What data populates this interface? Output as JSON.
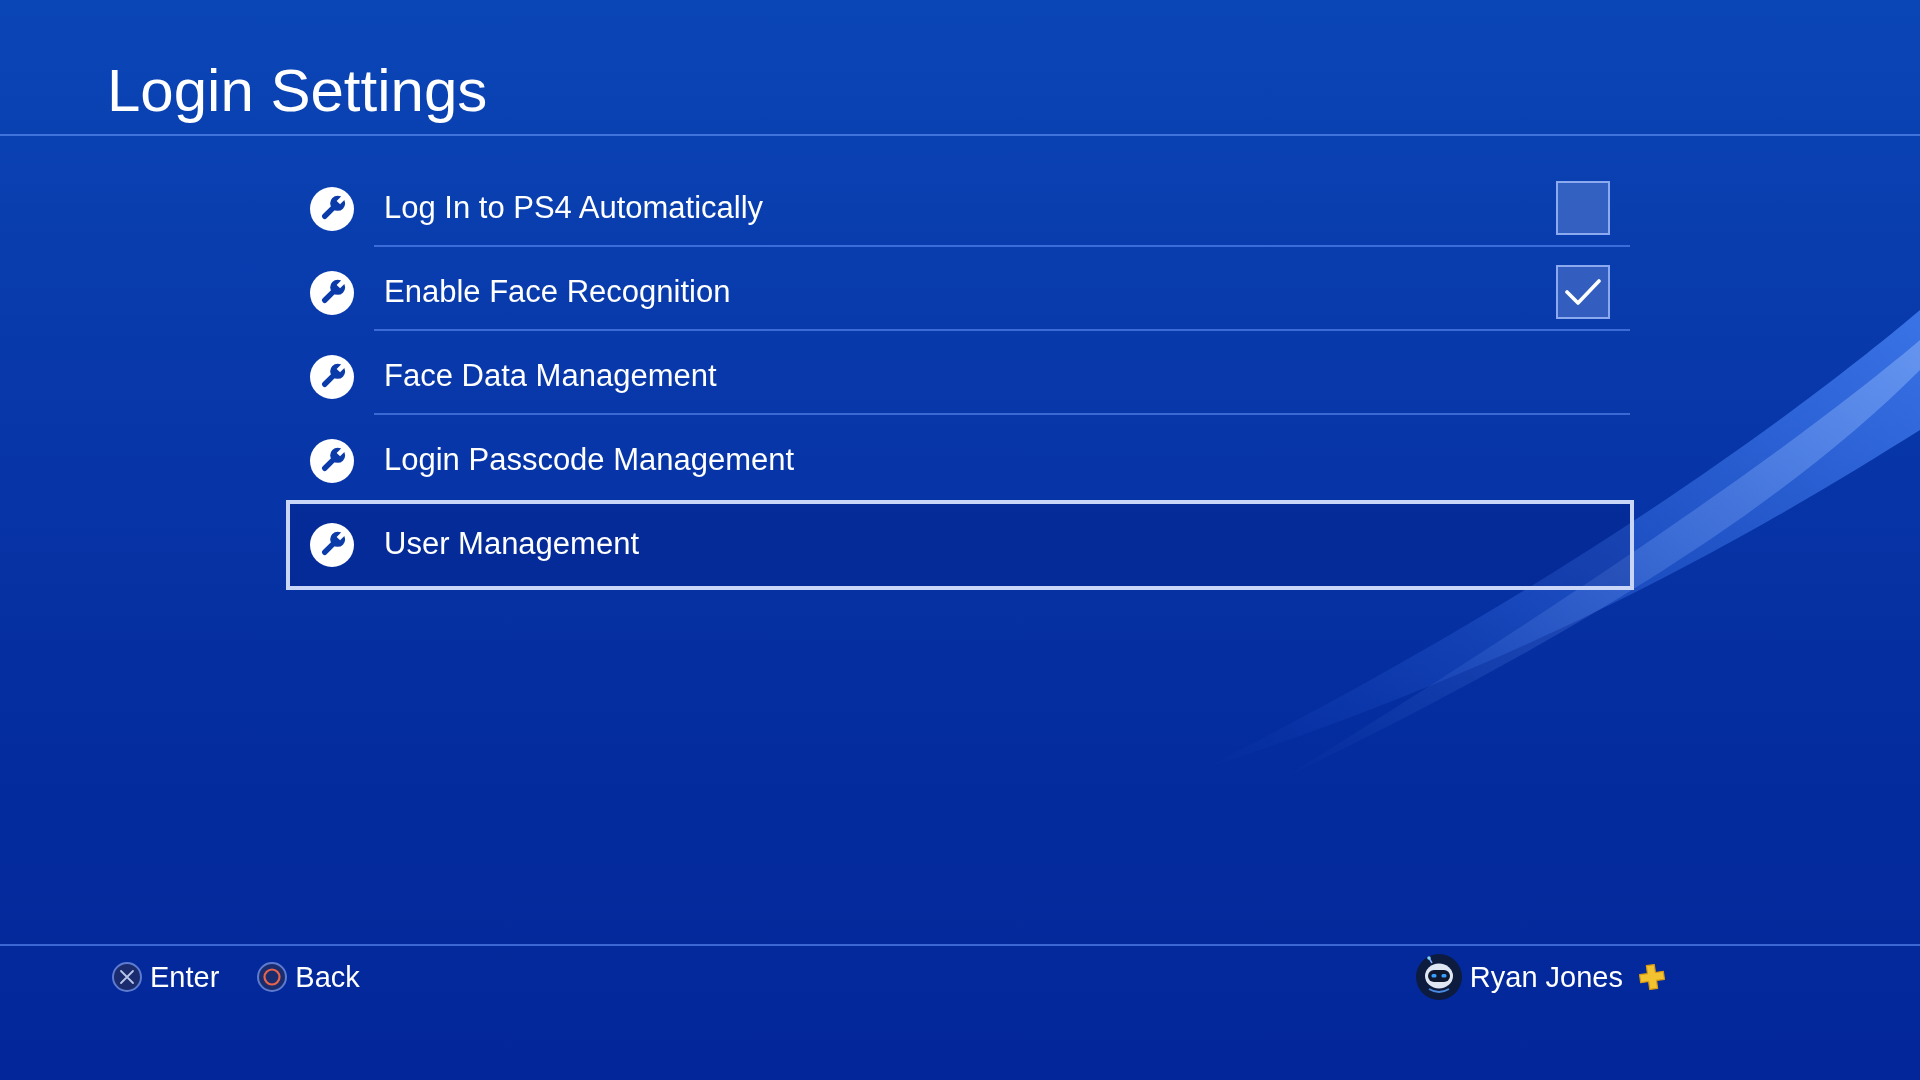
{
  "screen": {
    "title": "Login Settings"
  },
  "menu": {
    "items": [
      {
        "kind": "checkbox",
        "label": "Log In to PS4 Automatically",
        "checked": false,
        "selected": false
      },
      {
        "kind": "checkbox",
        "label": "Enable Face Recognition",
        "checked": true,
        "selected": false
      },
      {
        "kind": "link",
        "label": "Face Data Management",
        "selected": false
      },
      {
        "kind": "link",
        "label": "Login Passcode Management",
        "selected": false
      },
      {
        "kind": "link",
        "label": "User Management",
        "selected": true
      }
    ]
  },
  "footer": {
    "hints": [
      {
        "kind": "cross",
        "label": "Enter"
      },
      {
        "kind": "circle",
        "label": "Back"
      }
    ],
    "user": {
      "name": "Ryan Jones",
      "plus_member": true
    }
  }
}
